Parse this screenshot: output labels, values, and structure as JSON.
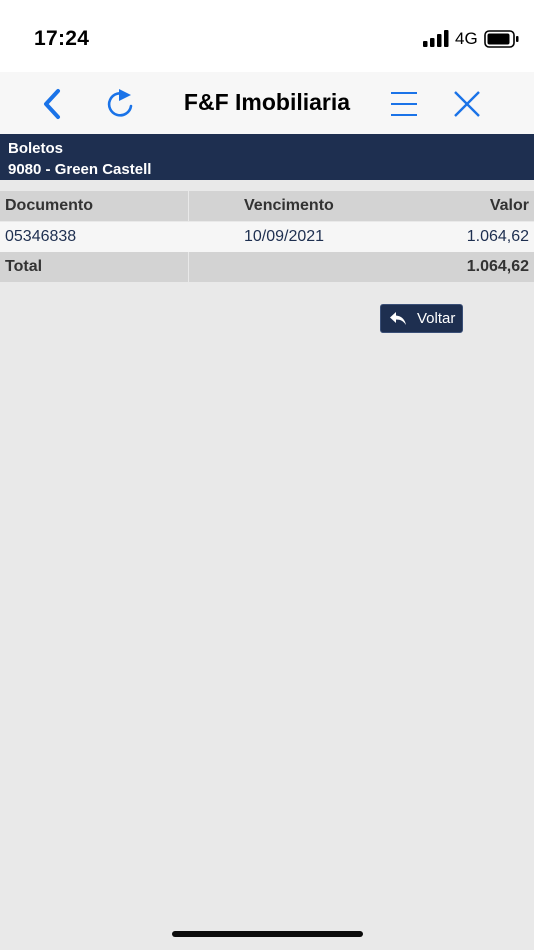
{
  "status_bar": {
    "time": "17:24",
    "network": "4G",
    "icons": [
      "signal-bars-icon",
      "battery-icon"
    ]
  },
  "nav": {
    "title": "F&F Imobiliaria",
    "icons": [
      "back-chevron-icon",
      "refresh-icon",
      "menu-icon",
      "close-icon"
    ],
    "accent_color": "#1a73e8"
  },
  "header": {
    "line1": "Boletos",
    "line2": "9080 - Green Castell",
    "background": "#1e2f50"
  },
  "table": {
    "columns": [
      "Documento",
      "Vencimento",
      "Valor"
    ],
    "rows": [
      {
        "documento": "05346838",
        "vencimento": "10/09/2021",
        "valor": "1.064,62"
      }
    ],
    "total": {
      "label": "Total",
      "valor": "1.064,62"
    }
  },
  "actions": {
    "voltar_label": "Voltar",
    "voltar_icon": "reply-arrow-icon"
  }
}
